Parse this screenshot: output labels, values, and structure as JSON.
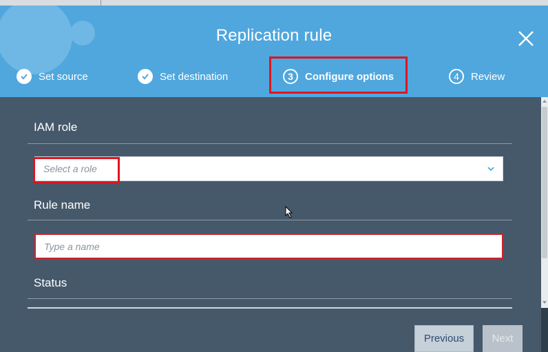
{
  "dialog": {
    "title": "Replication rule",
    "close_icon": "close-icon"
  },
  "steps": [
    {
      "number": "1",
      "label": "Set source",
      "state": "completed",
      "icon": "checkmark-icon"
    },
    {
      "number": "2",
      "label": "Set destination",
      "state": "completed",
      "icon": "checkmark-icon"
    },
    {
      "number": "3",
      "label": "Configure options",
      "state": "active"
    },
    {
      "number": "4",
      "label": "Review",
      "state": "pending"
    }
  ],
  "form": {
    "iam_role": {
      "label": "IAM role",
      "placeholder": "Select a role"
    },
    "rule_name": {
      "label": "Rule name",
      "placeholder": "Type a name",
      "value": ""
    },
    "status": {
      "label": "Status"
    }
  },
  "footer": {
    "previous_label": "Previous",
    "next_label": "Next"
  },
  "colors": {
    "header_bg": "#4fa7de",
    "body_bg": "#46596b",
    "highlight": "#e0141e",
    "error_border": "#c8242c"
  }
}
